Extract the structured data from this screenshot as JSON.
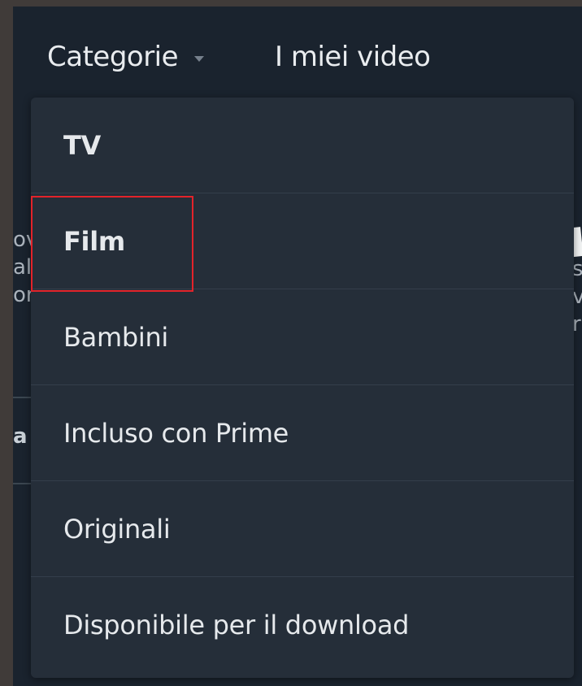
{
  "nav": {
    "categories_label": "Categorie",
    "my_videos_label": "I miei video"
  },
  "dropdown": {
    "items": [
      {
        "label": "TV"
      },
      {
        "label": "Film"
      },
      {
        "label": "Bambini"
      },
      {
        "label": "Incluso con Prime"
      },
      {
        "label": "Originali"
      },
      {
        "label": "Disponibile per il download"
      }
    ]
  },
  "background_fragments": {
    "left_text": "ov\nal\nor",
    "right_text": "s\nv,\nr",
    "left_bold": "a"
  },
  "colors": {
    "page_background": "#1a232e",
    "dropdown_background": "#252e39",
    "highlight_border": "#e3232a",
    "text": "#e6e9ec"
  },
  "icons": {
    "categories_caret": "chevron-down-icon"
  }
}
